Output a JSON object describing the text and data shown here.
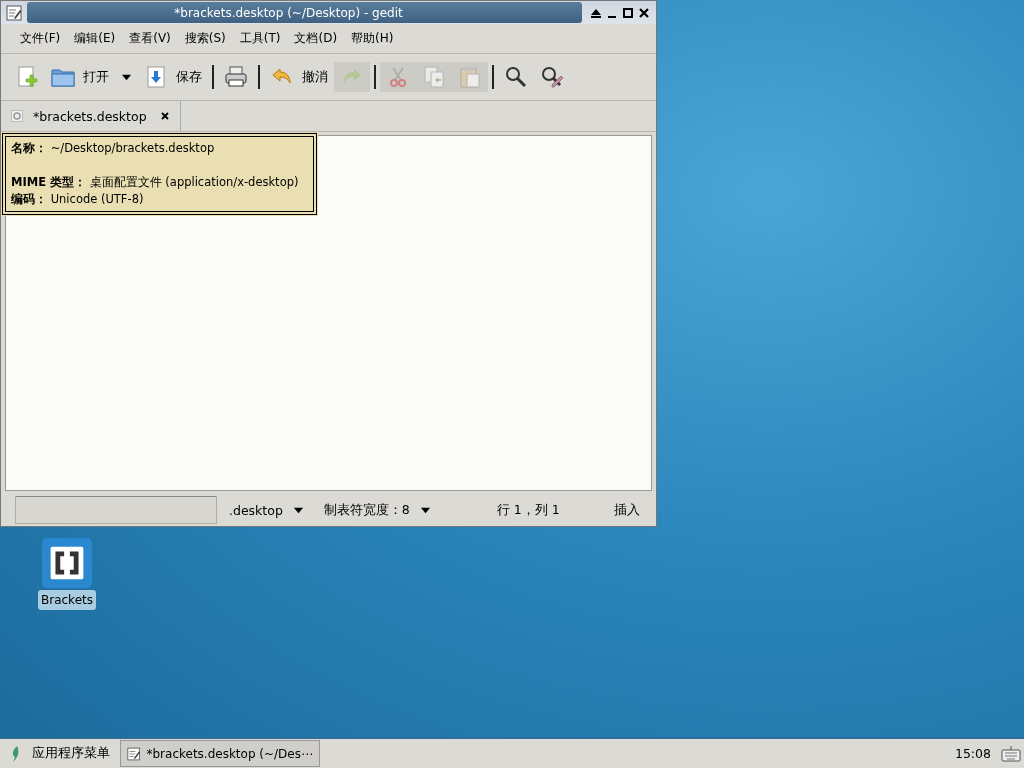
{
  "window": {
    "title": "*brackets.desktop (~/Desktop) - gedit"
  },
  "menu": [
    "文件(F)",
    "编辑(E)",
    "查看(V)",
    "搜索(S)",
    "工具(T)",
    "文档(D)",
    "帮助(H)"
  ],
  "toolbar": [
    {
      "kind": "new",
      "disabled": false
    },
    {
      "kind": "open",
      "label": "打开",
      "disabled": false
    },
    {
      "kind": "dropdown",
      "disabled": false
    },
    {
      "kind": "save",
      "label": "保存",
      "disabled": false
    },
    {
      "kind": "separator"
    },
    {
      "kind": "print",
      "disabled": false
    },
    {
      "kind": "separator"
    },
    {
      "kind": "undo",
      "label": "撤消",
      "disabled": false
    },
    {
      "kind": "redo",
      "disabled": true
    },
    {
      "kind": "separator"
    },
    {
      "kind": "cut",
      "disabled": true
    },
    {
      "kind": "copy",
      "disabled": true
    },
    {
      "kind": "paste",
      "disabled": true
    },
    {
      "kind": "separator"
    },
    {
      "kind": "search",
      "disabled": false
    },
    {
      "kind": "replace",
      "disabled": false
    }
  ],
  "tabs": [
    {
      "label": "*brackets.desktop",
      "selected": true
    }
  ],
  "tooltip": [
    {
      "label": "名称：",
      "value": "~/Desktop/brackets.desktop"
    },
    {
      "label": "MIME 类型：",
      "value": "桌面配置文件 (application/x-desktop)"
    },
    {
      "label": "编码：",
      "value": "Unicode (UTF-8)"
    }
  ],
  "status_bar": {
    "language": ".desktop",
    "tab_width": "制表符宽度：8",
    "position": "行 1，列 1",
    "mode": "插入"
  },
  "desktop_icons": [
    {
      "label": "Brackets",
      "selected": true
    }
  ],
  "taskbar": {
    "start": "应用程序菜单",
    "tasks": [
      {
        "label": "*brackets.desktop (~/Des⋯",
        "selected": false
      }
    ],
    "clock": "15:08"
  }
}
